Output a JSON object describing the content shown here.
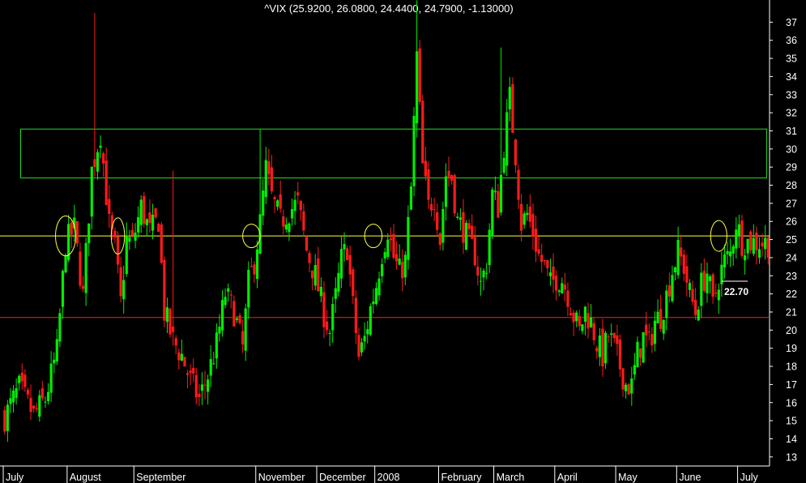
{
  "chart_data": {
    "type": "candlestick",
    "title": "^VIX (25.9200, 26.0800, 24.4400, 24.7900, -1.13000)",
    "y_axis": {
      "side": "right",
      "ylim": [
        12.5,
        38
      ],
      "ticks": [
        13,
        14,
        15,
        16,
        17,
        18,
        19,
        20,
        21,
        22,
        23,
        24,
        25,
        26,
        27,
        28,
        29,
        30,
        31,
        32,
        33,
        34,
        35,
        36,
        37
      ]
    },
    "x_axis": {
      "months": [
        {
          "label": "July",
          "index": 0
        },
        {
          "label": "August",
          "index": 22
        },
        {
          "label": "September",
          "index": 45
        },
        {
          "label": "November",
          "index": 87
        },
        {
          "label": "December",
          "index": 108
        },
        {
          "label": "2008",
          "index": 128
        },
        {
          "label": "February",
          "index": 150
        },
        {
          "label": "March",
          "index": 169
        },
        {
          "label": "April",
          "index": 190
        },
        {
          "label": "May",
          "index": 211
        },
        {
          "label": "June",
          "index": 232
        },
        {
          "label": "July",
          "index": 253
        }
      ],
      "count": 264
    },
    "series_path": [
      [
        0,
        15.2
      ],
      [
        5,
        16.8
      ],
      [
        10,
        15.3
      ],
      [
        14,
        16.2
      ],
      [
        18,
        18.8
      ],
      [
        21,
        24.8
      ],
      [
        24,
        25.6
      ],
      [
        27,
        21.9
      ],
      [
        30,
        28.8
      ],
      [
        33,
        30.9
      ],
      [
        36,
        25.8
      ],
      [
        38,
        24.5
      ],
      [
        40,
        21.5
      ],
      [
        42,
        25.0
      ],
      [
        44,
        24.8
      ],
      [
        47,
        26.8
      ],
      [
        50,
        25.4
      ],
      [
        53,
        26.1
      ],
      [
        55,
        21.0
      ],
      [
        58,
        19.4
      ],
      [
        61,
        18.6
      ],
      [
        64,
        17.2
      ],
      [
        67,
        16.2
      ],
      [
        70,
        17.5
      ],
      [
        73,
        19.2
      ],
      [
        76,
        22.0
      ],
      [
        79,
        21.0
      ],
      [
        82,
        19.0
      ],
      [
        84,
        22.6
      ],
      [
        86,
        23.8
      ],
      [
        88,
        25.9
      ],
      [
        90,
        28.9
      ],
      [
        92,
        27.3
      ],
      [
        95,
        26.0
      ],
      [
        98,
        26.6
      ],
      [
        101,
        27.0
      ],
      [
        104,
        24.4
      ],
      [
        107,
        23.0
      ],
      [
        110,
        20.9
      ],
      [
        112,
        19.9
      ],
      [
        114,
        21.8
      ],
      [
        116,
        23.9
      ],
      [
        118,
        24.6
      ],
      [
        120,
        21.3
      ],
      [
        122,
        18.5
      ],
      [
        124,
        19.5
      ],
      [
        126,
        21.2
      ],
      [
        128,
        22.5
      ],
      [
        130,
        24.3
      ],
      [
        132,
        25.6
      ],
      [
        134,
        24.0
      ],
      [
        136,
        23.2
      ],
      [
        138,
        23.8
      ],
      [
        140,
        27.8
      ],
      [
        142,
        35.1
      ],
      [
        144,
        29.0
      ],
      [
        146,
        26.8
      ],
      [
        148,
        27.4
      ],
      [
        150,
        25.0
      ],
      [
        152,
        28.6
      ],
      [
        154,
        28.4
      ],
      [
        156,
        26.0
      ],
      [
        158,
        25.6
      ],
      [
        160,
        24.8
      ],
      [
        162,
        24.2
      ],
      [
        164,
        22.5
      ],
      [
        166,
        23.7
      ],
      [
        168,
        27.5
      ],
      [
        170,
        26.8
      ],
      [
        172,
        30.2
      ],
      [
        174,
        32.8
      ],
      [
        176,
        29.7
      ],
      [
        178,
        25.9
      ],
      [
        180,
        26.4
      ],
      [
        182,
        25.4
      ],
      [
        184,
        24.1
      ],
      [
        186,
        23.5
      ],
      [
        188,
        22.5
      ],
      [
        190,
        22.9
      ],
      [
        192,
        22.8
      ],
      [
        194,
        22.0
      ],
      [
        196,
        20.8
      ],
      [
        198,
        19.9
      ],
      [
        200,
        21.1
      ],
      [
        202,
        20.4
      ],
      [
        204,
        19.3
      ],
      [
        206,
        18.6
      ],
      [
        208,
        19.7
      ],
      [
        210,
        19.0
      ],
      [
        212,
        18.0
      ],
      [
        214,
        17.0
      ],
      [
        216,
        16.9
      ],
      [
        218,
        18.7
      ],
      [
        220,
        19.6
      ],
      [
        222,
        19.2
      ],
      [
        224,
        20.5
      ],
      [
        226,
        20.8
      ],
      [
        228,
        21.9
      ],
      [
        230,
        23.3
      ],
      [
        232,
        24.3
      ],
      [
        234,
        23.5
      ],
      [
        236,
        22.0
      ],
      [
        238,
        21.0
      ],
      [
        240,
        22.5
      ],
      [
        242,
        23.2
      ],
      [
        244,
        21.3
      ],
      [
        246,
        22.9
      ],
      [
        248,
        23.8
      ],
      [
        250,
        24.2
      ],
      [
        252,
        26.0
      ],
      [
        254,
        24.9
      ],
      [
        263,
        24.8
      ]
    ],
    "spikes": [
      {
        "index": 31,
        "high": 37.5
      },
      {
        "index": 142,
        "high": 38.2
      },
      {
        "index": 171,
        "high": 35.6
      },
      {
        "index": 88,
        "high": 31.1
      },
      {
        "index": 58,
        "high": 28.8
      }
    ],
    "ref_lines": [
      {
        "value": 25.2,
        "color": "#ffff33"
      },
      {
        "value": 20.7,
        "color": "#ff2020"
      }
    ],
    "resistance_band": {
      "y_low": 28.4,
      "y_high": 31.1,
      "index_start": 6,
      "index_end": 263,
      "color": "#22dd22"
    },
    "circles": [
      {
        "index": 21,
        "value": 25.2,
        "rx_days": 3.5,
        "ry_value": 1.1
      },
      {
        "index": 39,
        "value": 25.2,
        "rx_days": 2.3,
        "ry_value": 1.0
      },
      {
        "index": 85,
        "value": 25.2,
        "rx_days": 3.0,
        "ry_value": 0.65
      },
      {
        "index": 127,
        "value": 25.2,
        "rx_days": 3.0,
        "ry_value": 0.65
      },
      {
        "index": 246,
        "value": 25.2,
        "rx_days": 2.8,
        "ry_value": 0.85
      }
    ],
    "annotation": {
      "text": "22.70",
      "value": 22.7,
      "index_start": 247,
      "index_end": 256
    },
    "up_color": "#00ee00",
    "down_color": "#ff1a1a"
  }
}
